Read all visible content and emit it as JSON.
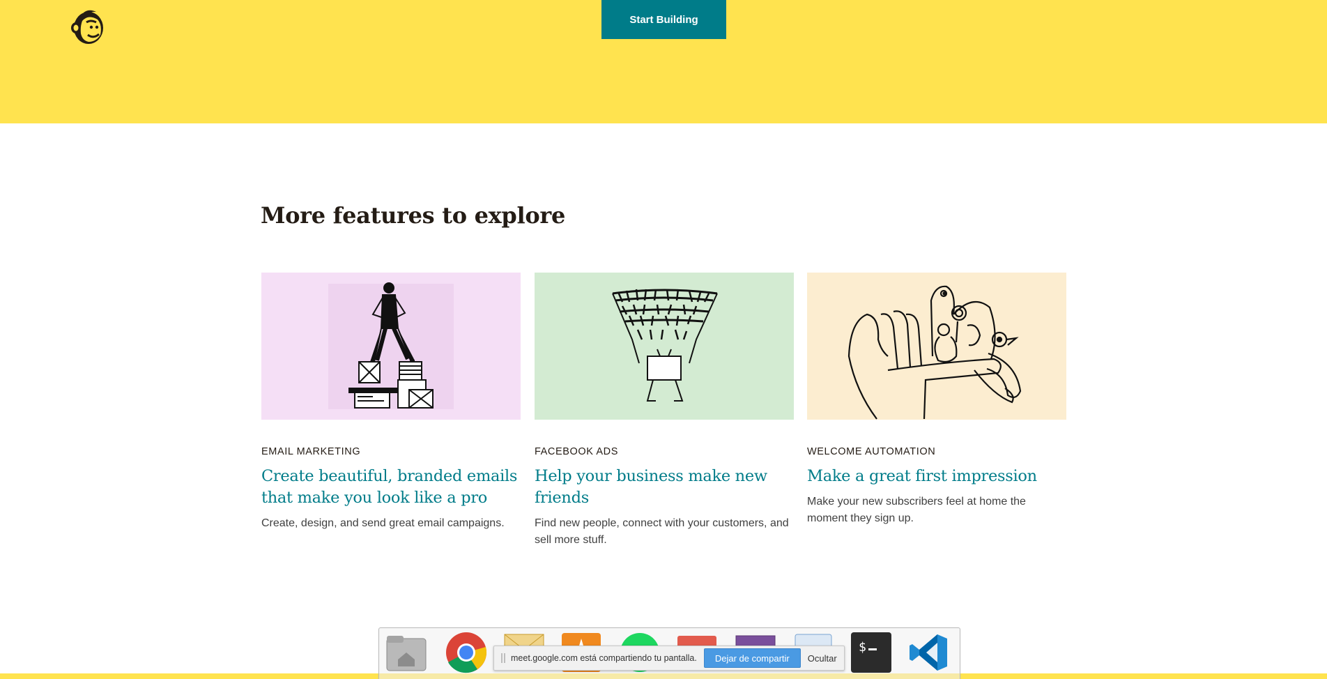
{
  "header": {
    "logo_icon": "mailchimp-freddie-icon",
    "cta_label": "Start Building",
    "background_color": "#ffe34f",
    "cta_color": "#007c89"
  },
  "features": {
    "title": "More features to explore",
    "cards": [
      {
        "eyebrow": "EMAIL MARKETING",
        "title": "Create beautiful, branded emails that make you look like a pro",
        "description": "Create, design, and send great email campaigns.",
        "image_bg": "#f5dff6",
        "illustration": "person-standing-on-boxes-illustration"
      },
      {
        "eyebrow": "FACEBOOK ADS",
        "title": "Help your business make new friends",
        "description": "Find new people, connect with your customers, and sell more stuff.",
        "image_bg": "#d3ebd2",
        "illustration": "people-funnel-illustration"
      },
      {
        "eyebrow": "WELCOME AUTOMATION",
        "title": "Make a great first impression",
        "description": "Make your new subscribers feel at home the moment they sign up.",
        "image_bg": "#fcedd0",
        "illustration": "hand-holding-creatures-illustration"
      }
    ]
  },
  "dock": {
    "icons": [
      "home-folder-icon",
      "chrome-icon",
      "mail-icon",
      "vlc-icon",
      "spotify-icon",
      "slides-icon",
      "image-viewer-icon",
      "document-icon",
      "terminal-icon",
      "vscode-icon"
    ]
  },
  "share_bar": {
    "message": "meet.google.com está compartiendo tu pantalla.",
    "stop_label": "Dejar de compartir",
    "hide_label": "Ocultar"
  }
}
